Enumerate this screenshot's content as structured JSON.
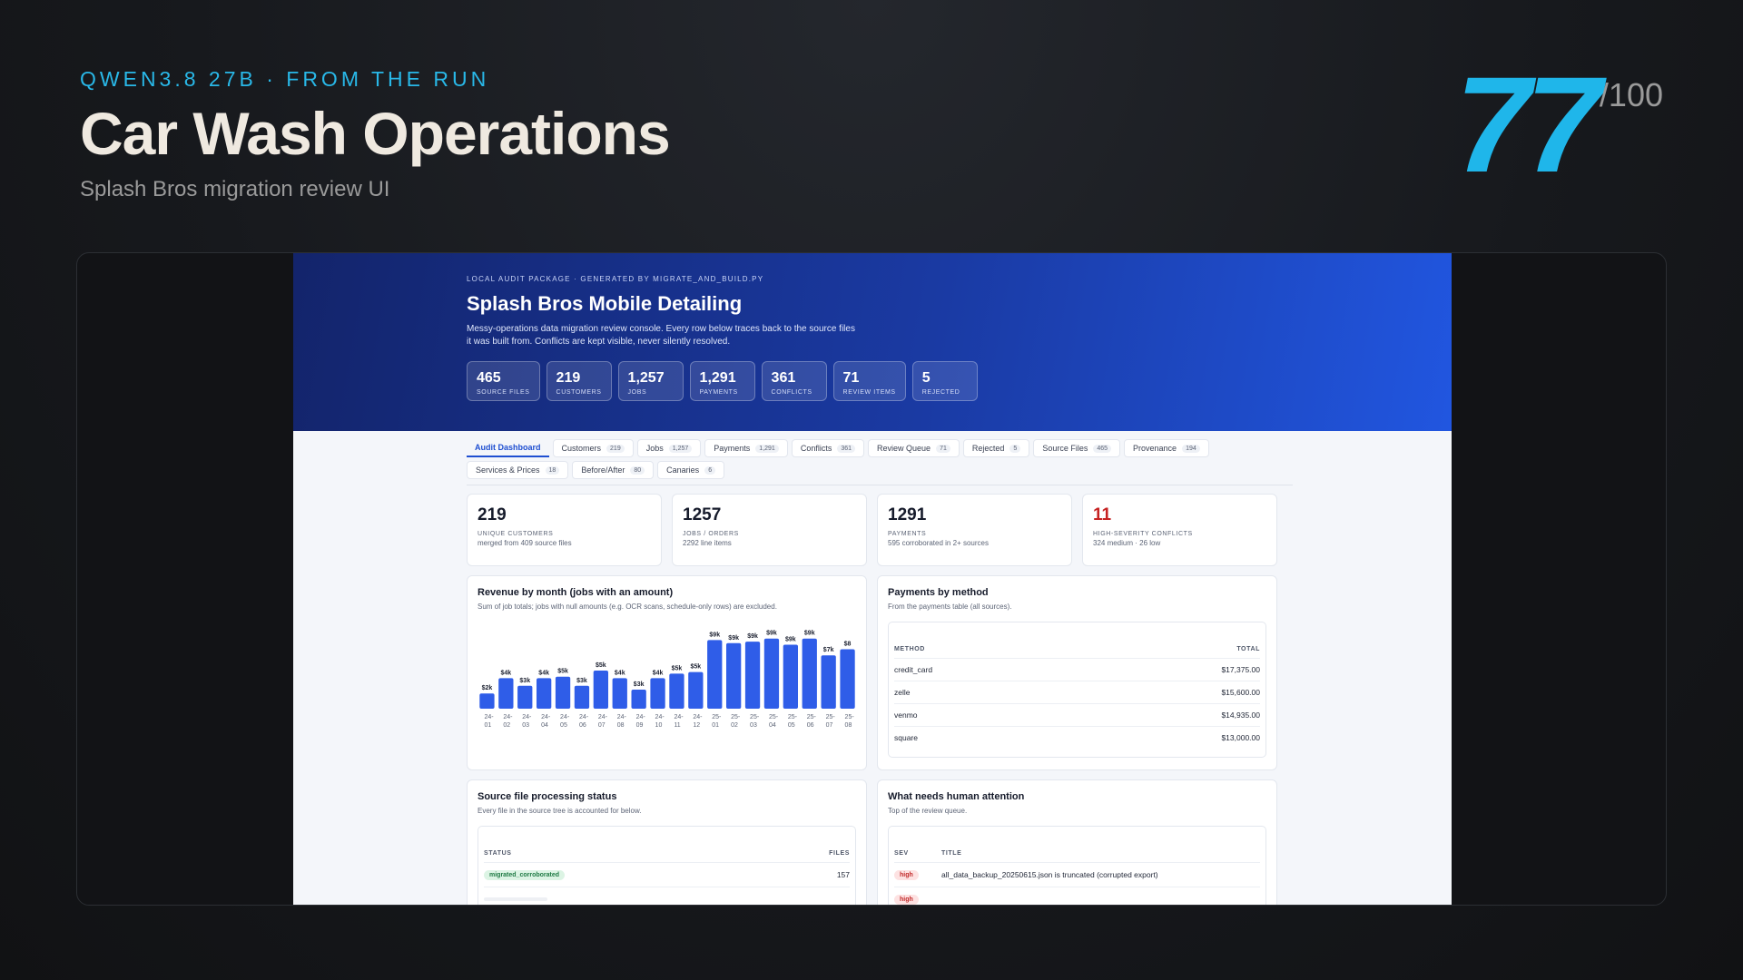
{
  "slide": {
    "eyebrow": "QWEN3.8 27B · FROM THE RUN",
    "title": "Car Wash Operations",
    "subtitle": "Splash Bros migration review UI",
    "score": "77",
    "score_den": "/100",
    "accent": "#1fb6ea"
  },
  "hero": {
    "eyebrow": "LOCAL AUDIT PACKAGE · GENERATED BY MIGRATE_AND_BUILD.PY",
    "title": "Splash Bros Mobile Detailing",
    "desc": "Messy-operations data migration review console. Every row below traces back to the source files it was built from. Conflicts are kept visible, never silently resolved.",
    "stats": [
      {
        "value": "465",
        "label": "Source files"
      },
      {
        "value": "219",
        "label": "Customers"
      },
      {
        "value": "1,257",
        "label": "Jobs"
      },
      {
        "value": "1,291",
        "label": "Payments"
      },
      {
        "value": "361",
        "label": "Conflicts"
      },
      {
        "value": "71",
        "label": "Review items"
      },
      {
        "value": "5",
        "label": "Rejected"
      }
    ]
  },
  "tabs": [
    {
      "label": "Audit Dashboard",
      "count": ""
    },
    {
      "label": "Customers",
      "count": "219"
    },
    {
      "label": "Jobs",
      "count": "1,257"
    },
    {
      "label": "Payments",
      "count": "1,291"
    },
    {
      "label": "Conflicts",
      "count": "361"
    },
    {
      "label": "Review Queue",
      "count": "71"
    },
    {
      "label": "Rejected",
      "count": "5"
    },
    {
      "label": "Source Files",
      "count": "465"
    },
    {
      "label": "Provenance",
      "count": "194"
    },
    {
      "label": "Services & Prices",
      "count": "18"
    },
    {
      "label": "Before/After",
      "count": "80"
    },
    {
      "label": "Canaries",
      "count": "6"
    }
  ],
  "kpis": [
    {
      "value": "219",
      "label": "Unique customers",
      "sub": "merged from 409 source files"
    },
    {
      "value": "1257",
      "label": "Jobs / orders",
      "sub": "2292 line items"
    },
    {
      "value": "1291",
      "label": "Payments",
      "sub": "595 corroborated in 2+ sources"
    },
    {
      "value": "11",
      "label": "High-severity conflicts",
      "sub": "324 medium · 26 low"
    }
  ],
  "revenue": {
    "title": "Revenue by month (jobs with an amount)",
    "sub": "Sum of job totals; jobs with null amounts (e.g. OCR scans, schedule-only rows) are excluded."
  },
  "chart_data": {
    "type": "bar",
    "title": "Revenue by month (jobs with an amount)",
    "categories": [
      "24-01",
      "24-02",
      "24-03",
      "24-04",
      "24-05",
      "24-06",
      "24-07",
      "24-08",
      "24-09",
      "24-10",
      "24-11",
      "24-12",
      "25-01",
      "25-02",
      "25-03",
      "25-04",
      "25-05",
      "25-06",
      "25-07",
      "25-08"
    ],
    "values": [
      2,
      4,
      3,
      4,
      4.2,
      3,
      5,
      4,
      2.5,
      4,
      4.6,
      4.8,
      9,
      8.6,
      8.8,
      9.2,
      8.4,
      9.2,
      7,
      7.8
    ],
    "data_labels": [
      "$2k",
      "$4k",
      "$3k",
      "$4k",
      "$5k",
      "$3k",
      "$5k",
      "$4k",
      "$3k",
      "$4k",
      "$5k",
      "$5k",
      "$9k",
      "$9k",
      "$9k",
      "$9k",
      "$9k",
      "$9k",
      "$7k",
      "$8"
    ],
    "units": "$k",
    "ylim": [
      0,
      10
    ],
    "color": "#2f5de8"
  },
  "payments": {
    "title": "Payments by method",
    "sub": "From the payments table (all sources).",
    "headers": [
      "Method",
      "Total"
    ],
    "rows": [
      {
        "method": "credit_card",
        "total": "$17,375.00"
      },
      {
        "method": "zelle",
        "total": "$15,600.00"
      },
      {
        "method": "venmo",
        "total": "$14,935.00"
      },
      {
        "method": "square",
        "total": "$13,000.00"
      }
    ]
  },
  "source_status": {
    "title": "Source file processing status",
    "sub": "Every file in the source tree is accounted for below.",
    "headers": [
      "Status",
      "Files"
    ],
    "rows": [
      {
        "status": "migrated_corroborated",
        "files": "157"
      },
      {
        "status": "",
        "files": ""
      }
    ]
  },
  "attention": {
    "title": "What needs human attention",
    "sub": "Top of the review queue.",
    "headers": [
      "Sev",
      "Title"
    ],
    "rows": [
      {
        "sev": "high",
        "title": "all_data_backup_20250615.json is truncated (corrupted export)"
      },
      {
        "sev": "high",
        "title": ""
      }
    ]
  }
}
